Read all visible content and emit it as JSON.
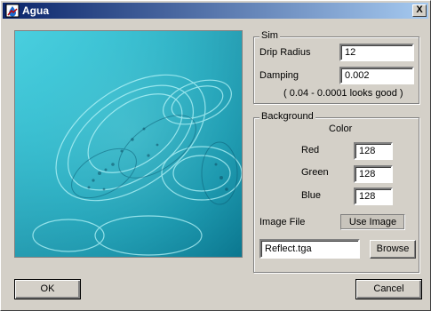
{
  "window": {
    "title": "Agua"
  },
  "icons": {
    "app": "water-drop-app-icon",
    "close": "close-icon"
  },
  "titlebar_buttons": {
    "close": "X"
  },
  "preview": {
    "image": "rippling cyan water surface"
  },
  "sim": {
    "legend": "Sim",
    "drip_radius_label": "Drip Radius",
    "drip_radius_value": "12",
    "damping_label": "Damping",
    "damping_value": "0.002",
    "hint": "( 0.04 - 0.0001 looks good )"
  },
  "background": {
    "legend": "Background",
    "color_label": "Color",
    "red_label": "Red",
    "red_value": "128",
    "green_label": "Green",
    "green_value": "128",
    "blue_label": "Blue",
    "blue_value": "128",
    "image_file_label": "Image File",
    "use_image_label": "Use Image",
    "file_value": "Reflect.tga",
    "browse_label": "Browse"
  },
  "footer": {
    "ok_label": "OK",
    "cancel_label": "Cancel"
  },
  "colors": {
    "titlebar_start": "#0a246a",
    "titlebar_end": "#a6caf0",
    "water": "#2ec8d8"
  }
}
